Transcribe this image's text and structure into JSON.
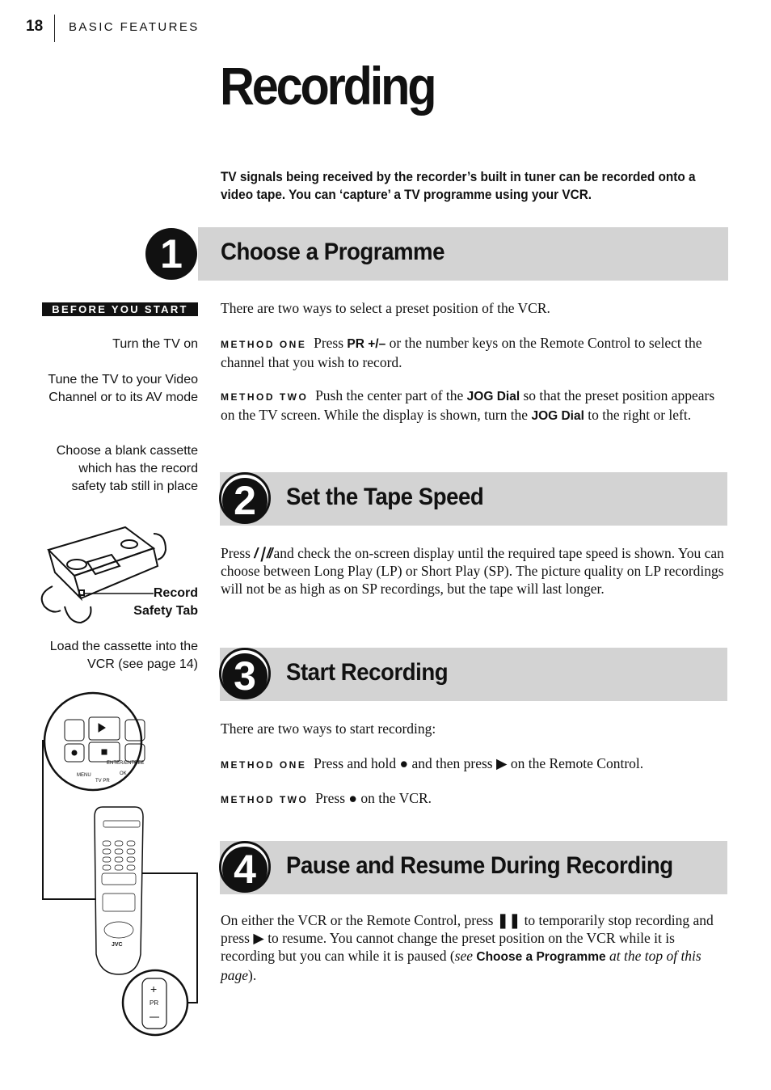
{
  "header": {
    "page_number": "18",
    "section": "BASIC FEATURES"
  },
  "title": "Recording",
  "intro": "TV signals being received by the recorder’s built in tuner can be recorded onto a video tape. You can ‘capture’ a TV programme using your VCR.",
  "sidebar": {
    "label": "BEFORE YOU START",
    "steps": [
      "Turn the TV on",
      "Tune the TV to your Video Channel or to its AV mode",
      "Choose a blank cassette which has the record safety tab still in place",
      "Load the cassette into the VCR (see page 14)"
    ],
    "cassette_label_1": "Record",
    "cassette_label_2": "Safety Tab",
    "remote": {
      "brand": "JVC",
      "menu": "MENU",
      "enter": "ENTER/ENTREE",
      "ok": "OK",
      "tv_pr": "TV  PR",
      "pr": "PR"
    }
  },
  "sections": [
    {
      "number": "1",
      "title": "Choose a Programme",
      "intro": "There are two ways to select a preset position of the VCR.",
      "m1_label": "METHOD ONE",
      "m1_a": "Press ",
      "m1_key": "PR +/–",
      "m1_b": " or the number keys on the Remote Control to select the channel that you wish to record.",
      "m2_label": "METHOD TWO",
      "m2_a": "Push the center part of the ",
      "m2_key1": "JOG Dial",
      "m2_b": " so that the preset position appears on the TV screen. While the display is shown, turn the ",
      "m2_key2": "JOG Dial",
      "m2_c": " to the right or left."
    },
    {
      "number": "2",
      "title": "Set the Tape Speed",
      "text_a": "Press ",
      "icon": "tape-speed-icon",
      "text_b": " and check the on-screen display until the required tape speed is shown. You can choose between Long Play (LP) or Short Play (SP). The picture quality on LP recordings will not be as high as on SP recordings, but the tape will last longer."
    },
    {
      "number": "3",
      "title": "Start Recording",
      "intro": "There are two ways to start recording:",
      "m1_label": "METHOD ONE",
      "m1_a": "Press and hold ",
      "m1_b": " and then press ",
      "m1_c": " on the Remote Control.",
      "m2_label": "METHOD TWO",
      "m2_a": "Press ",
      "m2_b": " on the VCR."
    },
    {
      "number": "4",
      "title": "Pause and Resume During Recording",
      "text_a": "On either the VCR or the Remote Control, press ",
      "text_b": " to temporarily stop recording and press ",
      "text_c": " to resume. You cannot change the preset position on the VCR while it is recording but you can while it is paused (",
      "see": "see ",
      "ref": "Choose a Programme",
      "text_d": " at the top of this page",
      "text_e": ")."
    }
  ]
}
